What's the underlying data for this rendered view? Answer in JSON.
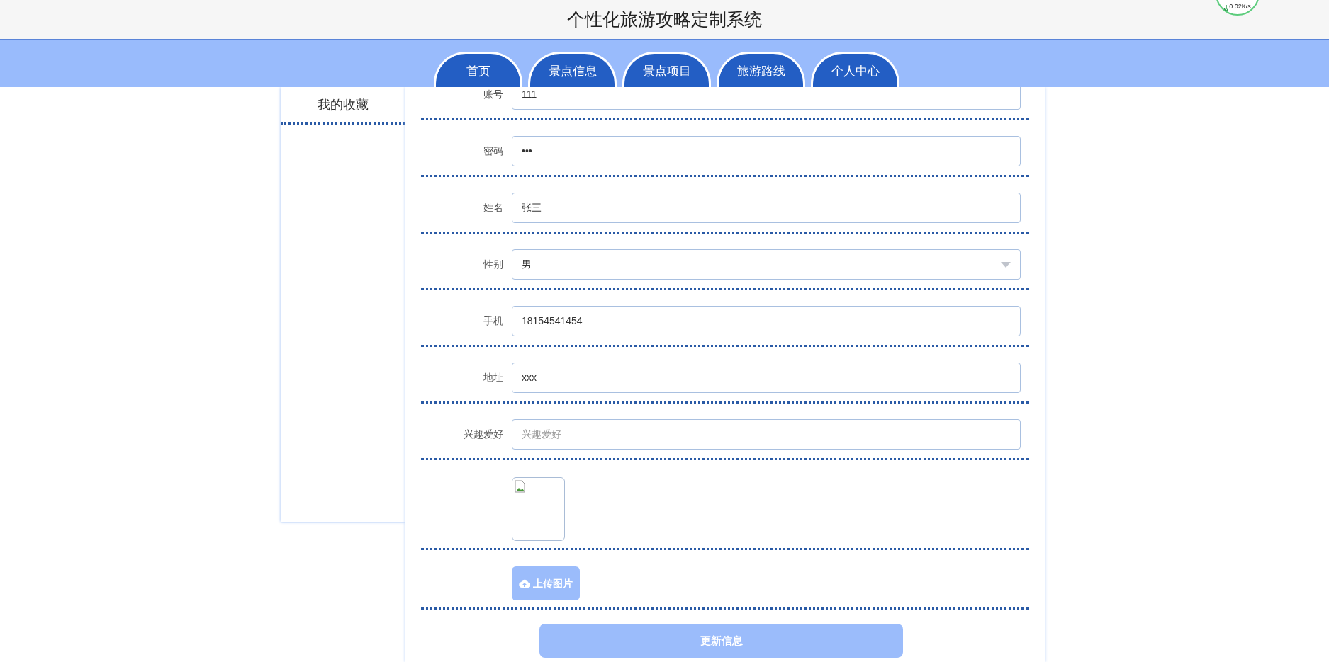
{
  "header": {
    "title": "个性化旅游攻略定制系统",
    "speed_widget": {
      "reading": "0.02K/s"
    }
  },
  "nav": {
    "tabs": [
      {
        "label": "首页"
      },
      {
        "label": "景点信息"
      },
      {
        "label": "景点项目"
      },
      {
        "label": "旅游路线"
      },
      {
        "label": "个人中心"
      }
    ]
  },
  "sidebar": {
    "items": [
      {
        "label": "我的收藏"
      }
    ]
  },
  "form": {
    "fields": [
      {
        "kind": "text",
        "label": "账号",
        "value": "111"
      },
      {
        "kind": "password",
        "label": "密码",
        "value": "•••"
      },
      {
        "kind": "text",
        "label": "姓名",
        "value": "张三"
      },
      {
        "kind": "select",
        "label": "性别",
        "value": "男"
      },
      {
        "kind": "text",
        "label": "手机",
        "value": "18154541454"
      },
      {
        "kind": "text",
        "label": "地址",
        "value": "xxx"
      },
      {
        "kind": "text",
        "label": "兴趣爱好",
        "placeholder": "兴趣爱好"
      },
      {
        "kind": "image"
      },
      {
        "kind": "upload",
        "button": "上传图片"
      }
    ],
    "submit": "更新信息"
  }
}
